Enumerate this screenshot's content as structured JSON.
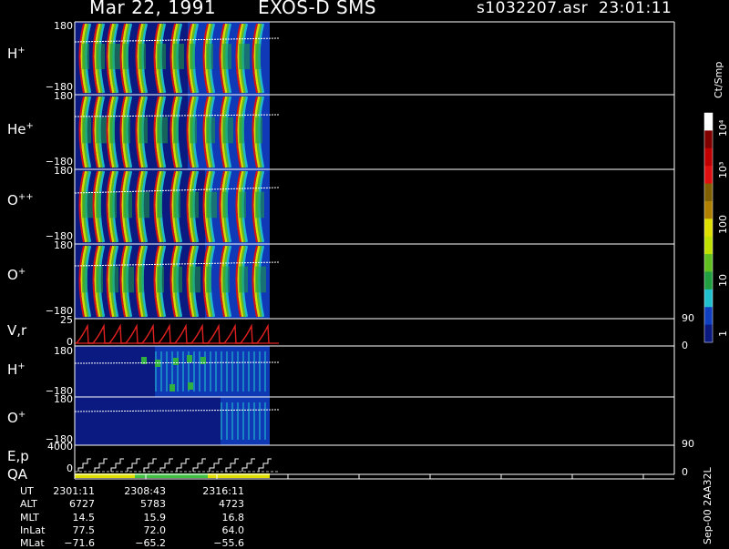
{
  "header": {
    "date": "Mar 22, 1991",
    "instrument": "EXOS-D SMS",
    "file": "s1032207.asr",
    "time": "23:01:11"
  },
  "panels": [
    {
      "label_base": "H",
      "label_sup": "+",
      "ytop": "180",
      "ybot": "−180"
    },
    {
      "label_base": "He",
      "label_sup": "+",
      "ytop": "180",
      "ybot": "−180"
    },
    {
      "label_base": "O",
      "label_sup": "++",
      "ytop": "180",
      "ybot": "−180"
    },
    {
      "label_base": "O",
      "label_sup": "+",
      "ytop": "180",
      "ybot": "−180"
    },
    {
      "label_base": "V,r",
      "label_sup": "",
      "ytop": "25",
      "ybot": "0",
      "rtop": "90",
      "rbot": "0"
    },
    {
      "label_base": "H",
      "label_sup": "+",
      "ytop": "180",
      "ybot": "−180"
    },
    {
      "label_base": "O",
      "label_sup": "+",
      "ytop": "180",
      "ybot": "−180"
    },
    {
      "label_base": "E,p",
      "label_sup": "",
      "label2": "QA",
      "ytop": "4000",
      "ybot": "0",
      "rtop": "90",
      "rbot": "0"
    }
  ],
  "colorbar": {
    "unit": "Ct/Smp",
    "ticks": [
      "1",
      "10",
      "100",
      "10³",
      "10⁴"
    ],
    "colors": [
      "#0a1a80",
      "#1040c0",
      "#20c0d0",
      "#20a040",
      "#60c020",
      "#c0e000",
      "#e0e000",
      "#b08000",
      "#806000",
      "#e01010",
      "#c00000",
      "#800000",
      "#ffffff"
    ]
  },
  "footer_id": "Sep-00 2AA32L",
  "ephemeris": {
    "labels": [
      "UT",
      "ALT",
      "MLT",
      "InLat",
      "MLat"
    ],
    "columns": [
      {
        "UT": "2301:11",
        "ALT": "6727",
        "MLT": "14.5",
        "InLat": "77.5",
        "MLat": "−71.6"
      },
      {
        "UT": "2308:43",
        "ALT": "5783",
        "MLT": "15.9",
        "InLat": "72.0",
        "MLat": "−65.2"
      },
      {
        "UT": "2316:11",
        "ALT": "4723",
        "MLT": "16.8",
        "InLat": "64.0",
        "MLat": "−55.6"
      }
    ]
  }
}
